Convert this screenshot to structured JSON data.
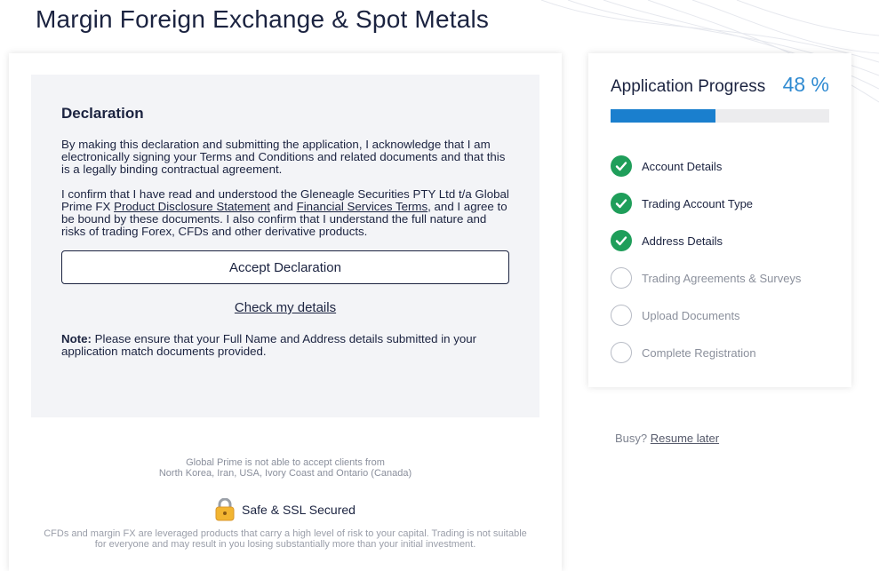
{
  "page": {
    "title": "Margin Foreign Exchange & Spot Metals"
  },
  "declaration": {
    "heading": "Declaration",
    "paragraph1": "By making this declaration and submitting the application, I acknowledge that I am electronically signing your Terms and Conditions and related documents and that this is a legally binding contractual agreement.",
    "paragraph2_prefix": "I confirm that I have read and understood the Gleneagle Securities PTY Ltd t/a Global Prime FX ",
    "pds_link": "Product Disclosure Statement",
    "and_text": " and ",
    "fst_link": "Financial Services Terms",
    "paragraph2_suffix": ", and I agree to be bound by these documents. I also confirm that I understand the full nature and risks of trading Forex, CFDs and other derivative products.",
    "accept_button": "Accept Declaration",
    "check_link": "Check my details",
    "note_label": "Note:",
    "note_text": " Please ensure that your Full Name and Address details submitted in your application match documents provided."
  },
  "footer": {
    "restriction_line1": "Global Prime is not able to accept clients from",
    "restriction_line2": "North Korea, Iran, USA, Ivory Coast and Ontario (Canada)",
    "ssl_text": "Safe & SSL Secured",
    "risk_warning": "CFDs and margin FX are leveraged products that carry a high level of risk to your capital. Trading is not suitable for everyone and may result in you losing substantially more than your initial investment."
  },
  "progress": {
    "title": "Application Progress",
    "percent_label": "48 %",
    "percent_value": 48,
    "steps": [
      {
        "label": "Account Details",
        "status": "done"
      },
      {
        "label": "Trading Account Type",
        "status": "done"
      },
      {
        "label": "Address Details",
        "status": "done"
      },
      {
        "label": "Trading Agreements & Surveys",
        "status": "todo"
      },
      {
        "label": "Upload Documents",
        "status": "todo"
      },
      {
        "label": "Complete Registration",
        "status": "todo"
      }
    ]
  },
  "busy": {
    "prefix": "Busy? ",
    "link": "Resume later"
  },
  "colors": {
    "accent": "#1a7fce",
    "percent": "#2f8ad1",
    "done": "#1f9e5a",
    "text": "#1b2340"
  },
  "icons": {
    "step_done": "check-icon",
    "ssl": "padlock-icon"
  }
}
